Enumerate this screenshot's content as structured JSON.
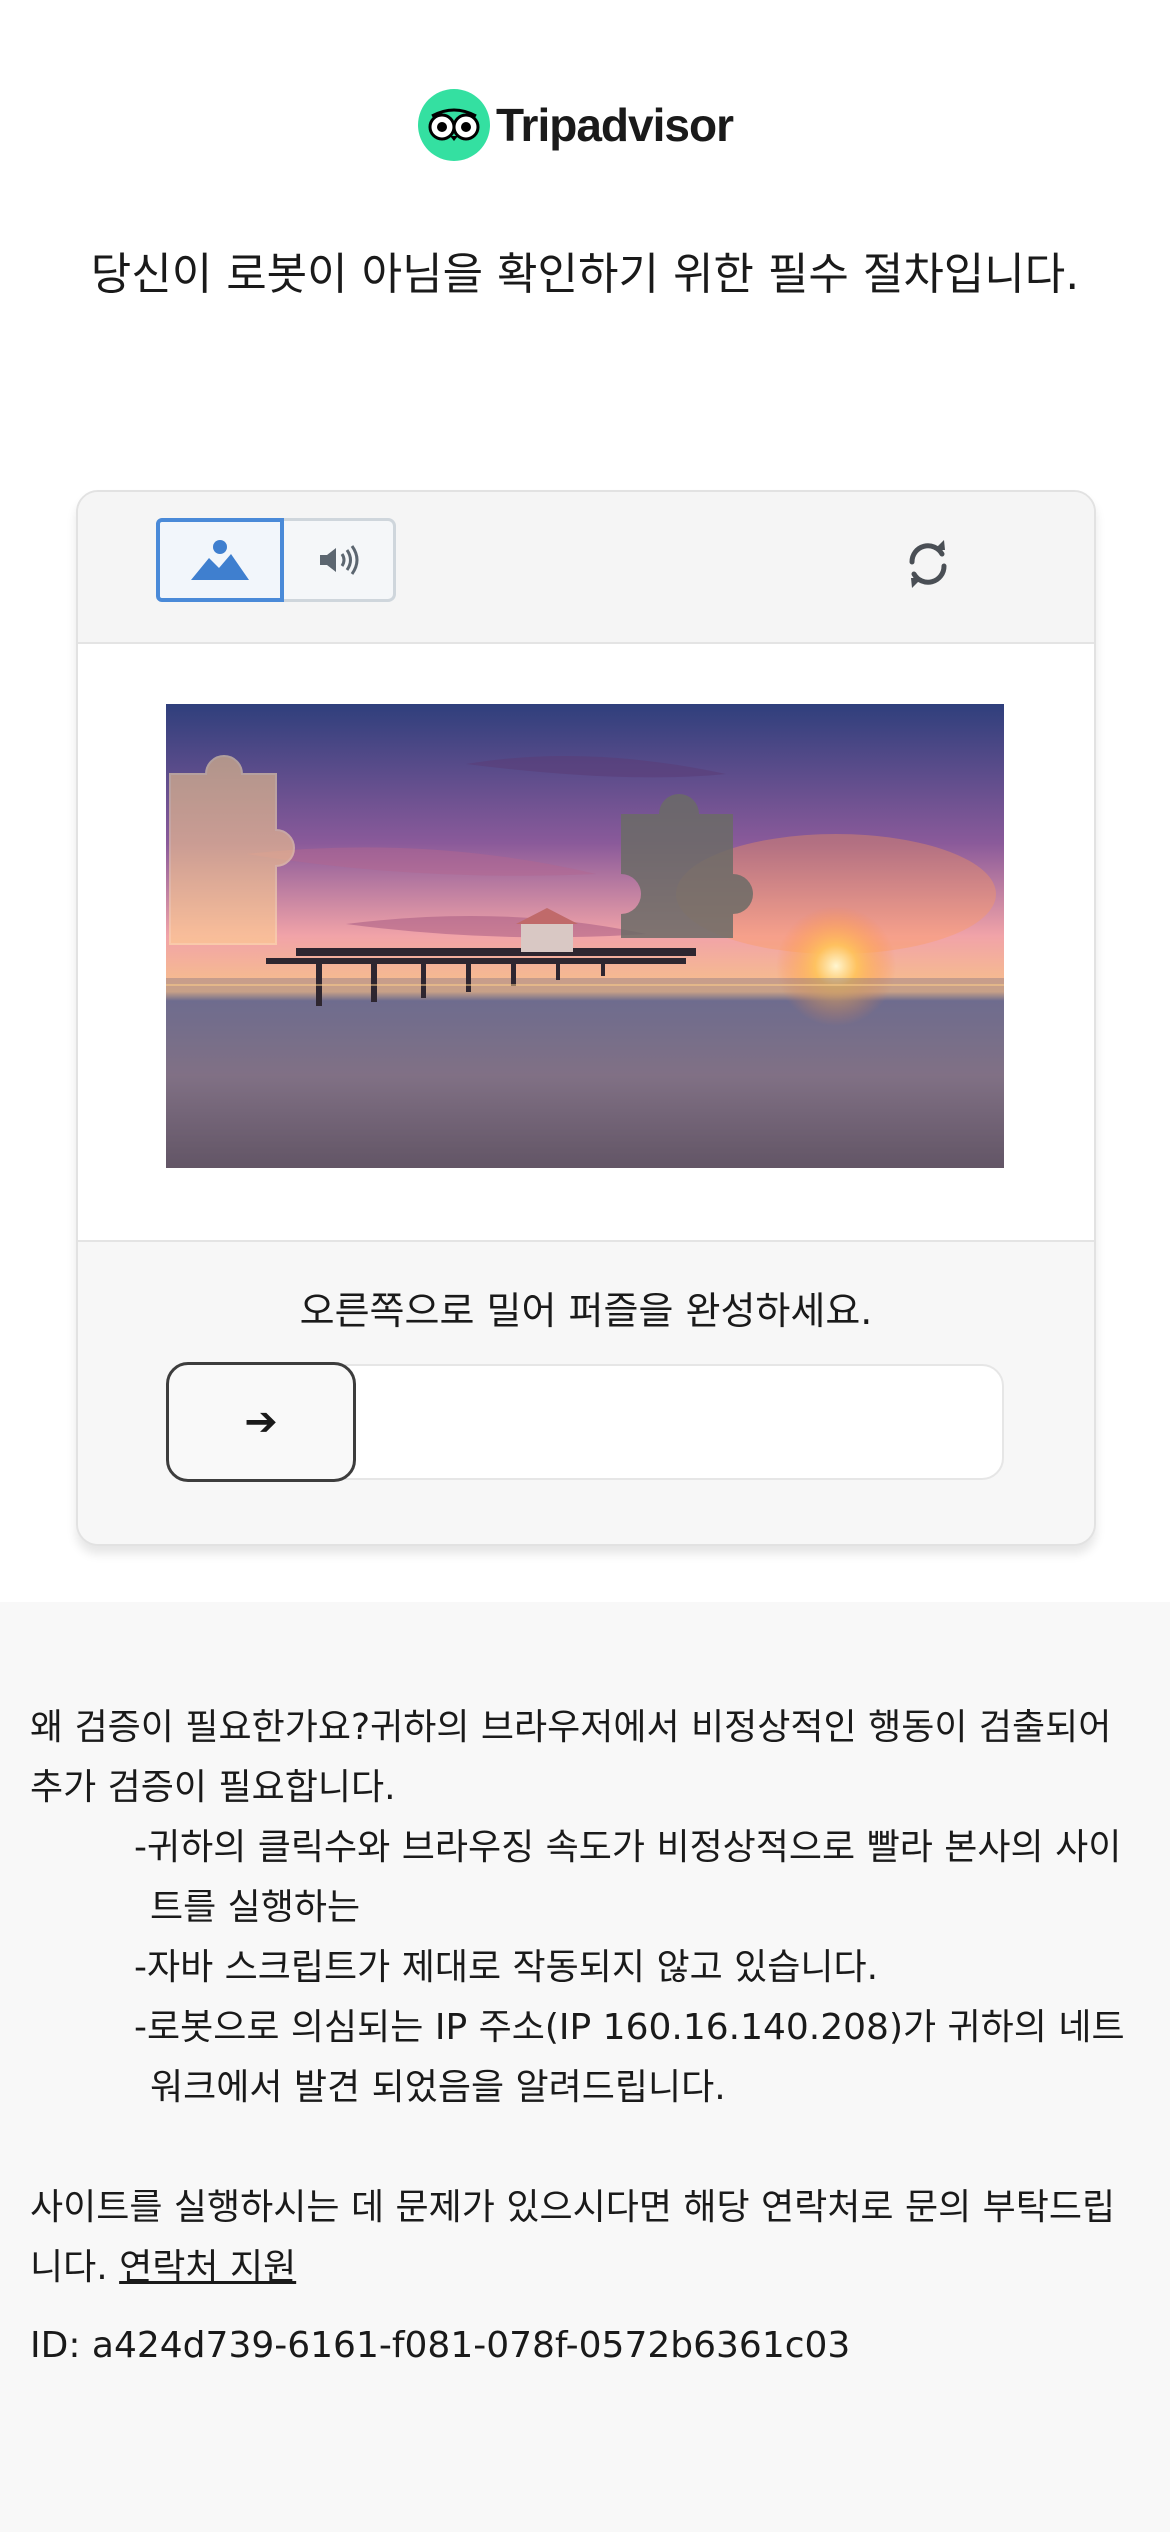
{
  "brand": {
    "name": "Tripadvisor",
    "accent_color": "#34e0a1"
  },
  "headline": "당신이 로봇이 아님을 확인하기 위한 필수 절차입니다.",
  "captcha": {
    "modes": [
      {
        "icon": "image-icon",
        "active": true
      },
      {
        "icon": "speaker-icon",
        "active": false
      }
    ],
    "refresh_icon": "refresh-icon",
    "instruction": "오른쪽으로 밀어 퍼즐을 완성하세요.",
    "slider_arrow": "➔",
    "slider_progress": 0,
    "accent_color": "#4a8ad8"
  },
  "info": {
    "question": "왜 검증이 필요한가요?귀하의 브라우저에서 비정상적인 행동이 검출되어 추가 검증이 필요합니다.",
    "reasons": [
      "-귀하의 클릭수와 브라우징 속도가 비정상적으로 빨라 본사의 사이트를 실행하는",
      "-자바 스크립트가 제대로 작동되지 않고 있습니다.",
      "-로봇으로 의심되는 IP 주소(IP 160.16.140.208)가 귀하의 네트워크에서 발견 되었음을 알려드립니다."
    ],
    "contact_text": "사이트를 실행하시는 데 문제가 있으시다면 해당 연락처로 문의 부탁드립니다.",
    "contact_link": "연락처 지원",
    "id_line": "ID: a424d739-6161-f081-078f-0572b6361c03"
  }
}
